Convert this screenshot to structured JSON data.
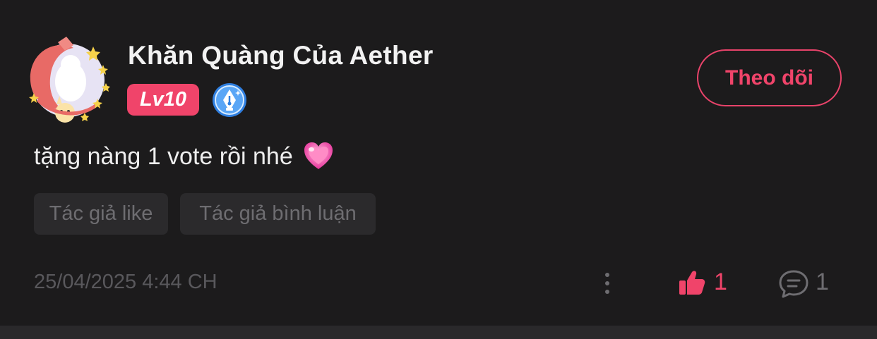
{
  "comment": {
    "user": {
      "name": "Khăn Quàng Của Aether",
      "level": "Lv10",
      "avatar_icon": "avatar-frame-stars",
      "badge_icon": "pen-nib-badge-icon"
    },
    "follow_label": "Theo dõi",
    "text": "tặng nàng 1 vote rồi nhé",
    "emoji_icon": "heart-icon",
    "tags": [
      "Tác giả like",
      "Tác giả bình luận"
    ],
    "timestamp": "25/04/2025 4:44 CH",
    "actions": {
      "more_icon": "more-vertical-icon",
      "like_icon": "thumbs-up-icon",
      "like_count": "1",
      "reply_icon": "comment-bubble-icon",
      "reply_count": "1"
    }
  },
  "colors": {
    "background": "#1c1b1c",
    "accent": "#f0446a",
    "tag_background": "#2b2a2c",
    "muted_text": "#6e6d71"
  }
}
